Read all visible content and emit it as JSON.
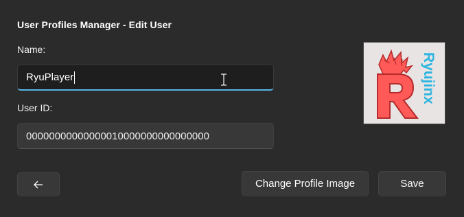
{
  "dialog": {
    "title": "User Profiles Manager - Edit User"
  },
  "form": {
    "name_label": "Name:",
    "name_value": "RyuPlayer",
    "userid_label": "User ID:",
    "userid_value": "00000000000000010000000000000000"
  },
  "avatar": {
    "logo_text": "Ryujinx",
    "logo_letter": "R",
    "colors": {
      "background": "#e9e4e4",
      "letter": "#ff5a57",
      "text": "#2cb5e0"
    }
  },
  "buttons": {
    "back_icon": "arrow-left-icon",
    "change_image_label": "Change Profile Image",
    "save_label": "Save"
  },
  "colors": {
    "window_bg": "#2b2b2b",
    "accent": "#59b6e6"
  }
}
